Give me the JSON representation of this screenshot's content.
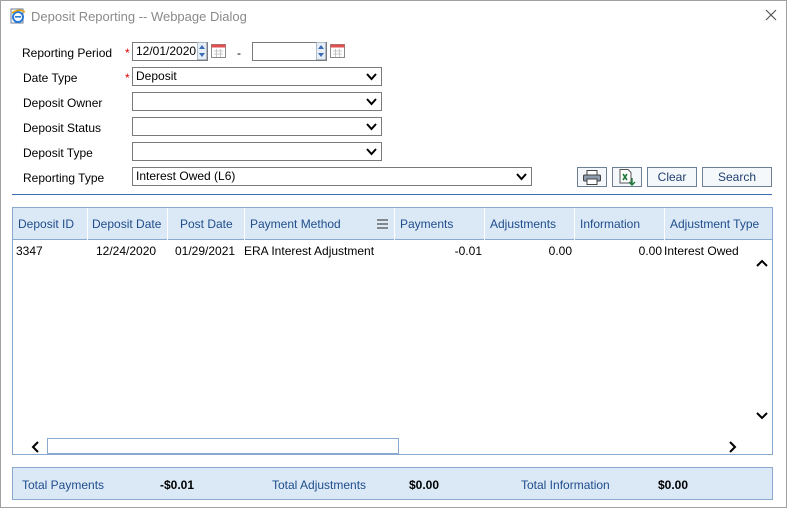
{
  "window": {
    "title": "Deposit Reporting -- Webpage Dialog"
  },
  "form": {
    "reporting_period_label": "Reporting Period",
    "required_mark": "*",
    "period_start": "12/01/2020",
    "period_separator": "-",
    "period_end": "",
    "date_type_label": "Date Type",
    "date_type_value": "Deposit",
    "deposit_owner_label": "Deposit Owner",
    "deposit_owner_value": "",
    "deposit_status_label": "Deposit Status",
    "deposit_status_value": "",
    "deposit_type_label": "Deposit Type",
    "deposit_type_value": "",
    "reporting_type_label": "Reporting Type",
    "reporting_type_value": "Interest Owed (L6)"
  },
  "toolbar": {
    "print_icon": "printer-icon",
    "export_icon": "excel-export-icon",
    "clear_label": "Clear",
    "search_label": "Search"
  },
  "grid": {
    "columns": [
      "Deposit ID",
      "Deposit Date",
      "Post Date",
      "Payment Method",
      "Payments",
      "Adjustments",
      "Information",
      "Adjustment Type"
    ],
    "rows": [
      [
        "3347",
        "12/24/2020",
        "01/29/2021",
        "ERA Interest Adjustment",
        "-0.01",
        "0.00",
        "0.00",
        "Interest Owed"
      ]
    ]
  },
  "totals": {
    "payments_label": "Total Payments",
    "payments_value": "-$0.01",
    "adjustments_label": "Total Adjustments",
    "adjustments_value": "$0.00",
    "information_label": "Total Information",
    "information_value": "$0.00"
  },
  "colors": {
    "header_bg": "#dbe8f6",
    "header_text": "#1f4d8c",
    "border": "#8aa9cf",
    "required": "#dd0000"
  }
}
